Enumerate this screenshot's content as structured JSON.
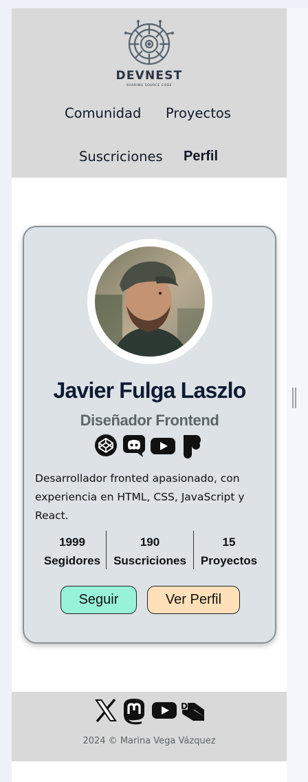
{
  "header": {
    "brand": "DEVNEST",
    "tagline": "SHARING SOURCE CODE",
    "nav": [
      "Comunidad",
      "Proyectos",
      "Suscriciones",
      "Perfil"
    ],
    "active_nav": "Perfil"
  },
  "profile": {
    "name": "Javier Fulga Laszlo",
    "role": "Diseñador Frontend",
    "social_icons": [
      "codepen-icon",
      "discord-icon",
      "youtube-icon",
      "figma-icon"
    ],
    "bio": "Desarrollador fronted apasionado, con experiencia en HTML, CSS, JavaScript y React.",
    "stats": [
      {
        "value": "1999",
        "label": "Segidores"
      },
      {
        "value": "190",
        "label": "Suscriciones"
      },
      {
        "value": "15",
        "label": "Proyectos"
      }
    ],
    "buttons": {
      "follow": "Seguir",
      "view_profile": "Ver Perfil"
    }
  },
  "footer": {
    "social_icons": [
      "x-icon",
      "mastodon-icon",
      "youtube-icon",
      "dev-to-icon"
    ],
    "copyright": "2024 © Marina Vega Vázquez"
  },
  "colors": {
    "header_bg": "#d8d9d8",
    "card_bg": "#dce2e5",
    "follow_button": "#98f2d9",
    "view_button": "#ffe0b8",
    "name_text": "#0f1b33",
    "role_text": "#5d6666"
  }
}
